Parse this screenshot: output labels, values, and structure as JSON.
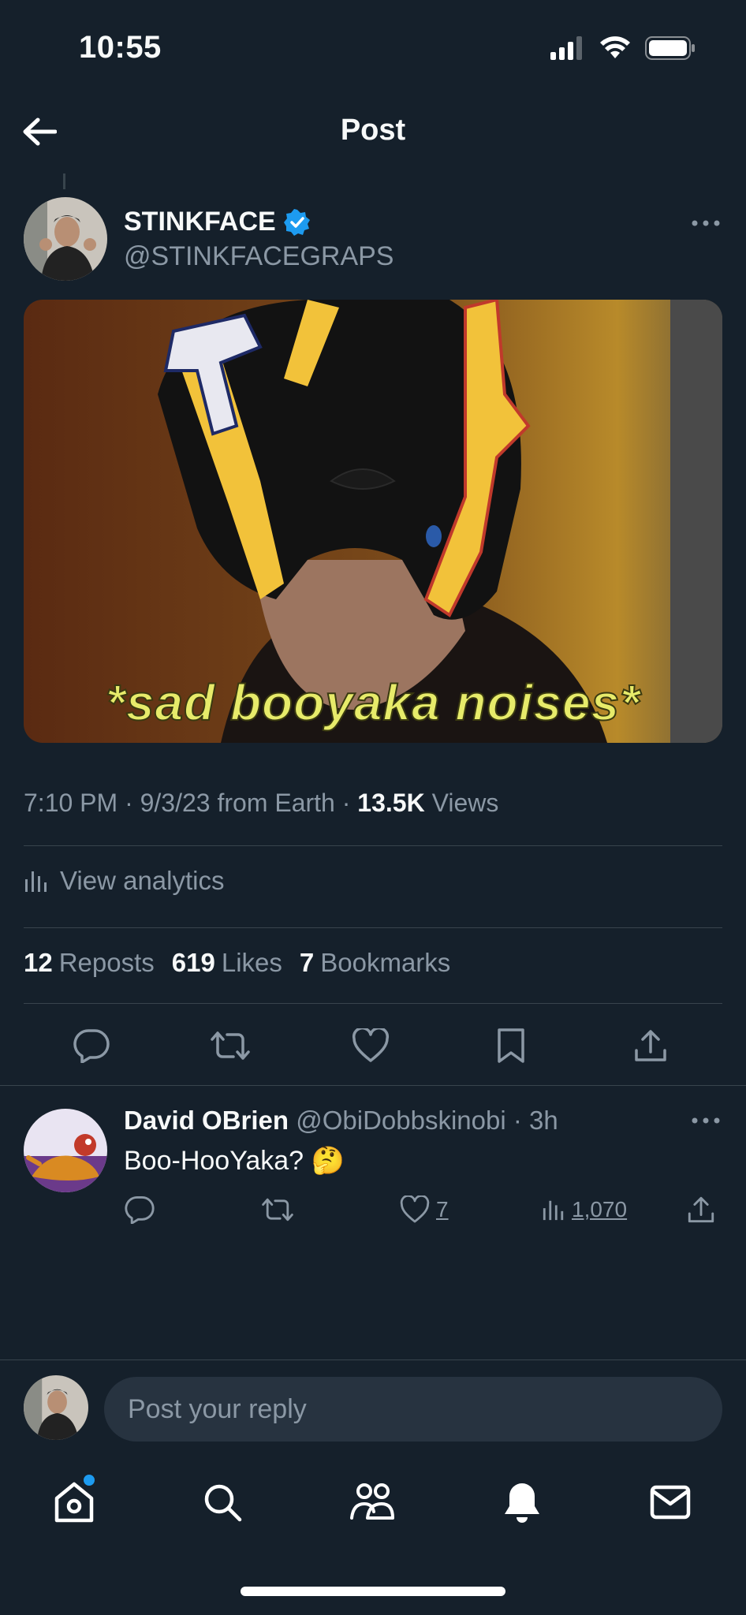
{
  "status_bar": {
    "time": "10:55"
  },
  "header": {
    "title": "Post"
  },
  "post": {
    "author_name": "STINKFACE",
    "author_handle": "@STINKFACEGRAPS",
    "media_caption": "*sad booyaka noises*",
    "time": "7:10 PM",
    "date": "9/3/23",
    "source": "from Earth",
    "views_count": "13.5K",
    "views_label": "Views",
    "analytics_label": "View analytics",
    "reposts_count": "12",
    "reposts_label": "Reposts",
    "likes_count": "619",
    "likes_label": "Likes",
    "bookmarks_count": "7",
    "bookmarks_label": "Bookmarks"
  },
  "reply": {
    "name": "David OBrien",
    "handle": "@ObiDobbskinobi",
    "time": "3h",
    "text": "Boo-HooYaka? 🤔",
    "likes": "7",
    "views": "1,070"
  },
  "composer": {
    "placeholder": "Post your reply"
  },
  "colors": {
    "background": "#15202b",
    "accent": "#1d9bf0",
    "muted": "#8b98a5",
    "divider": "#38444d"
  },
  "icons": [
    "back-arrow-icon",
    "verified-badge-icon",
    "more-icon",
    "reply-icon",
    "repost-icon",
    "like-icon",
    "bookmark-icon",
    "share-icon",
    "analytics-icon",
    "home-icon",
    "search-icon",
    "communities-icon",
    "notifications-icon",
    "messages-icon"
  ]
}
